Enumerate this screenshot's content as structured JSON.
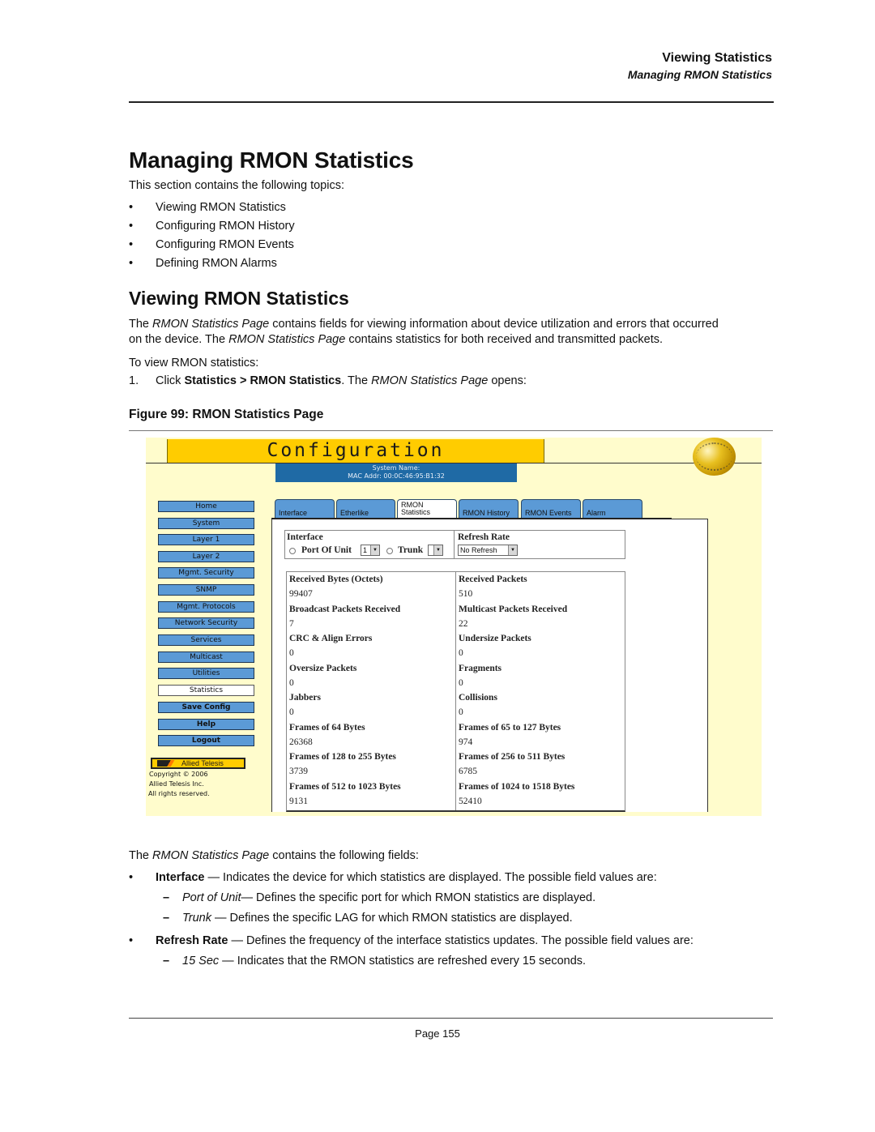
{
  "header": {
    "section": "Viewing Statistics",
    "subsection": "Managing RMON Statistics"
  },
  "title": "Managing RMON Statistics",
  "intro": "This section contains the following topics:",
  "topics": [
    "Viewing RMON Statistics",
    "Configuring RMON History",
    "Configuring RMON Events",
    "Defining RMON Alarms"
  ],
  "bullet_glyph": "•",
  "dash_glyph": "–",
  "section2": {
    "title": "Viewing RMON Statistics",
    "para1_lead": "The ",
    "para1_em": "RMON Statistics Page",
    "para1_tail": " contains fields for viewing information about device utilization and errors that occurred",
    "para2_lead": "on the device. The ",
    "para2_em": "RMON Statistics Page",
    "para2_tail": " contains statistics for both received and transmitted packets.",
    "to_view": "To view RMON statistics:",
    "step_num": "1.",
    "step_lead": "Click ",
    "step_bold": "Statistics > RMON Statistics",
    "step_mid": ". The ",
    "step_em": "RMON Statistics Page",
    "step_tail": " opens:",
    "figure_caption": "Figure 99:  RMON Statistics Page"
  },
  "screenshot": {
    "banner": "Configuration",
    "system_name": "System Name:",
    "mac_addr": "MAC Addr: 00:0C:46:95:B1:32",
    "nav": [
      {
        "label": "Home"
      },
      {
        "label": "System"
      },
      {
        "label": "Layer 1"
      },
      {
        "label": "Layer 2"
      },
      {
        "label": "Mgmt. Security"
      },
      {
        "label": "SNMP"
      },
      {
        "label": "Mgmt. Protocols"
      },
      {
        "label": "Network Security"
      },
      {
        "label": "Services"
      },
      {
        "label": "Multicast"
      },
      {
        "label": "Utilities"
      },
      {
        "label": "Statistics",
        "active": true
      },
      {
        "label": "Save Config"
      },
      {
        "label": "Help"
      },
      {
        "label": "Logout"
      }
    ],
    "logo": "Allied Telesis",
    "copyright": [
      "Copyright © 2006",
      "Allied Telesis  Inc.",
      "All rights reserved."
    ],
    "tabs": [
      {
        "label": "Interface"
      },
      {
        "label": "Etherlike"
      },
      {
        "label": "RMON Statistics",
        "line1": "RMON",
        "line2": "Statistics",
        "active": true
      },
      {
        "label": "RMON History"
      },
      {
        "label": "RMON Events"
      },
      {
        "label": "Alarm"
      }
    ],
    "interface_label": "Interface",
    "port_of_unit_label": "Port Of Unit",
    "port_of_unit_value": "1",
    "trunk_label": "Trunk",
    "trunk_value": "",
    "refresh_rate_label": "Refresh Rate",
    "refresh_rate_value": "No Refresh",
    "stats": [
      {
        "left_label": "Received Bytes (Octets)",
        "left_value": "99407",
        "right_label": "Received Packets",
        "right_value": "510"
      },
      {
        "left_label": "Broadcast Packets Received",
        "left_value": "7",
        "right_label": "Multicast Packets Received",
        "right_value": "22"
      },
      {
        "left_label": "CRC & Align Errors",
        "left_value": "0",
        "right_label": "Undersize Packets",
        "right_value": "0"
      },
      {
        "left_label": "Oversize Packets",
        "left_value": "0",
        "right_label": "Fragments",
        "right_value": "0"
      },
      {
        "left_label": "Jabbers",
        "left_value": "0",
        "right_label": "Collisions",
        "right_value": "0"
      },
      {
        "left_label": "Frames of 64 Bytes",
        "left_value": "26368",
        "right_label": "Frames of 65 to 127 Bytes",
        "right_value": "974"
      },
      {
        "left_label": "Frames of 128 to 255 Bytes",
        "left_value": "3739",
        "right_label": "Frames of 256 to 511 Bytes",
        "right_value": "6785"
      },
      {
        "left_label": "Frames of 512 to 1023 Bytes",
        "left_value": "9131",
        "right_label": "Frames of 1024 to 1518 Bytes",
        "right_value": "52410"
      }
    ]
  },
  "fields_intro": {
    "lead": "The ",
    "em": "RMON Statistics Page",
    "tail": " contains the following fields:"
  },
  "fields": [
    {
      "name": "Interface",
      "desc": " — Indicates the device for which statistics are displayed. The possible field values are:",
      "values": [
        {
          "name": "Port of Unit",
          "desc": "— Defines the specific port for which RMON statistics are displayed."
        },
        {
          "name": "Trunk",
          "desc": " — Defines the specific LAG for which RMON statistics are displayed."
        }
      ]
    },
    {
      "name": "Refresh Rate",
      "desc": " — Defines the frequency of the interface statistics updates. The possible field values are:",
      "values": [
        {
          "name": "15 Sec",
          "desc": " — Indicates that the RMON statistics are refreshed every 15 seconds."
        }
      ]
    }
  ],
  "footer": {
    "page": "Page 155"
  }
}
